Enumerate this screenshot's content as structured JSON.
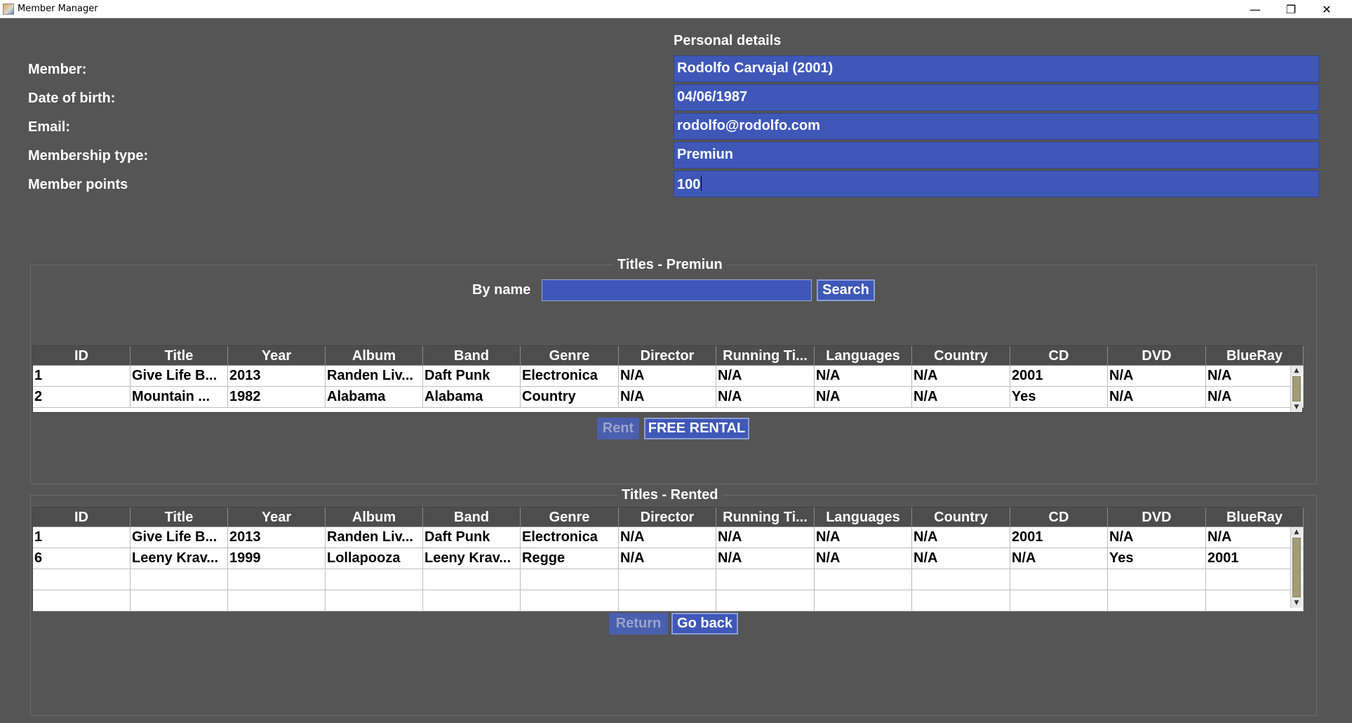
{
  "window": {
    "title": "Member Manager",
    "controls": {
      "minimize": "—",
      "maximize": "❐",
      "close": "✕"
    }
  },
  "personal": {
    "heading": "Personal details",
    "member_label": "Member:",
    "member_value": "Rodolfo Carvajal (2001)",
    "dob_label": "Date of birth:",
    "dob_value": "04/06/1987",
    "email_label": "Email:",
    "email_value": "rodolfo@rodolfo.com",
    "type_label": "Membership type:",
    "type_value": "Premiun",
    "points_label": "Member points",
    "points_value": "100"
  },
  "titles_panel": {
    "title": "Titles - Premiun",
    "by_name_label": "By name",
    "search_value": "",
    "search_button": "Search",
    "rent_button": "Rent",
    "free_rental_button": "FREE RENTAL"
  },
  "rented_panel": {
    "title": "Titles - Rented",
    "return_button": "Return",
    "go_back_button": "Go back"
  },
  "columns": [
    "ID",
    "Title",
    "Year",
    "Album",
    "Band",
    "Genre",
    "Director",
    "Running Ti...",
    "Languages",
    "Country",
    "CD",
    "DVD",
    "BlueRay"
  ],
  "titles_rows": [
    [
      "1",
      "Give Life B...",
      "2013",
      "Randen Liv...",
      "Daft Punk",
      "Electronica",
      "N/A",
      "N/A",
      "N/A",
      "N/A",
      "2001",
      "N/A",
      "N/A"
    ],
    [
      "2",
      "Mountain ...",
      "1982",
      "Alabama",
      "Alabama",
      "Country",
      "N/A",
      "N/A",
      "N/A",
      "N/A",
      "Yes",
      "N/A",
      "N/A"
    ]
  ],
  "rented_rows": [
    [
      "1",
      "Give Life B...",
      "2013",
      "Randen Liv...",
      "Daft Punk",
      "Electronica",
      "N/A",
      "N/A",
      "N/A",
      "N/A",
      "2001",
      "N/A",
      "N/A"
    ],
    [
      "6",
      "Leeny Krav...",
      "1999",
      "Lollapooza",
      "Leeny Krav...",
      "Regge",
      "N/A",
      "N/A",
      "N/A",
      "N/A",
      "N/A",
      "Yes",
      "2001"
    ],
    [
      "",
      "",
      "",
      "",
      "",
      "",
      "",
      "",
      "",
      "",
      "",
      "",
      ""
    ],
    [
      "",
      "",
      "",
      "",
      "",
      "",
      "",
      "",
      "",
      "",
      "",
      "",
      ""
    ]
  ],
  "colors": {
    "background": "#555555",
    "field_blue": "#3f58b8",
    "header_gray": "#4d4d4d"
  }
}
